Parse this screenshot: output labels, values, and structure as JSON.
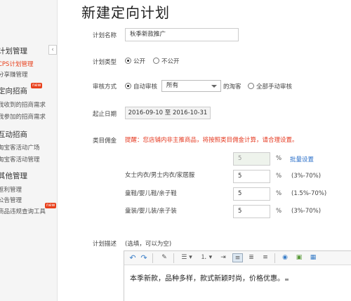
{
  "page_title": "新建定向计划",
  "sidebar": {
    "collapse_icon": "‹",
    "sections": [
      {
        "label": "计划管理",
        "items": [
          {
            "label": "CPS计划管理",
            "active": true
          },
          {
            "label": "分享赚管理"
          }
        ]
      },
      {
        "label": "定向招商",
        "badge": "new",
        "items": [
          {
            "label": "我收到的招商需求"
          },
          {
            "label": "我参加的招商需求"
          }
        ]
      },
      {
        "label": "互动招商",
        "items": [
          {
            "label": "淘宝客活动广场"
          },
          {
            "label": "淘宝客活动管理"
          }
        ]
      },
      {
        "label": "其他管理",
        "items": [
          {
            "label": "返利管理"
          },
          {
            "label": "公告管理"
          },
          {
            "label": "商品违规查询工具",
            "badge": "new"
          }
        ]
      }
    ]
  },
  "form": {
    "plan_name": {
      "label": "计划名称",
      "value": "秋季新款推广"
    },
    "plan_type": {
      "label": "计划类型",
      "options": [
        "公开",
        "不公开"
      ],
      "selected": "公开"
    },
    "review": {
      "label": "审核方式",
      "auto_label": "自动审核",
      "select_value": "所有",
      "suffix": "的淘客",
      "manual_label": "全部手动审核",
      "selected": "自动审核"
    },
    "dates": {
      "label": "起止日期",
      "value": "2016-09-10 至 2016-10-31"
    },
    "commission": {
      "label": "类目佣金",
      "warning": "提醒：您店铺内非主推商品，将按照类目佣金计算，请合理设置。",
      "batch_value": "5",
      "percent": "%",
      "batch_link": "批量设置",
      "categories": [
        {
          "name": "女士内衣/男士内衣/家居服",
          "value": "5",
          "range": "(3%-70%)"
        },
        {
          "name": "童鞋/婴儿鞋/亲子鞋",
          "value": "5",
          "range": "(1.5%-70%)"
        },
        {
          "name": "童装/婴儿装/亲子装",
          "value": "5",
          "range": "(3%-70%)"
        }
      ]
    },
    "description": {
      "label": "计划描述",
      "hint": "(选填，可以为空)",
      "content": "本季新款，品种多样，款式新颖时尚，价格优惠。"
    }
  },
  "toolbar": {
    "undo": "↶",
    "redo": "↷",
    "brush": "✎",
    "ul": "☰ ▾",
    "ol": "⒈ ▾",
    "indent": "⇥",
    "align_left": "≡",
    "align_center": "≣",
    "align_right": "≡",
    "globe": "◉",
    "image": "▣",
    "table": "▦"
  }
}
